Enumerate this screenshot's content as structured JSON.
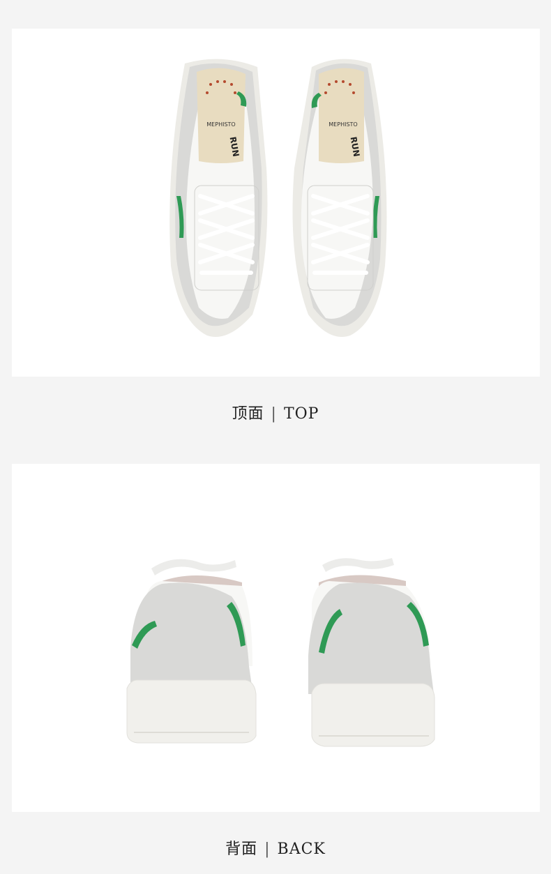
{
  "sections": [
    {
      "id": "top",
      "caption_cn": "顶面",
      "separator": "|",
      "caption_en": "TOP",
      "brand_on_insole": "MEPHISTO",
      "insole_text": "RUN",
      "side_logo": "MEPHISTO"
    },
    {
      "id": "back",
      "caption_cn": "背面",
      "separator": "|",
      "caption_en": "BACK"
    }
  ],
  "colors": {
    "page_background": "#f4f4f4",
    "panel_background": "#ffffff",
    "shoe_leather": "#f7f7f5",
    "suede_grey": "#d9d9d7",
    "accent_green": "#2f9a55",
    "insole_tan": "#e8dcc0",
    "sole_white": "#f1f0ec"
  }
}
